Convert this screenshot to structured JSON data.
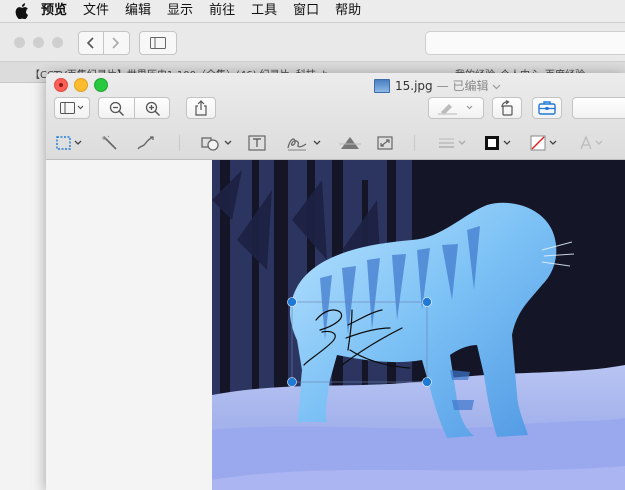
{
  "menubar": {
    "app_name": "预览",
    "items": [
      "文件",
      "编辑",
      "显示",
      "前往",
      "工具",
      "窗口",
      "帮助"
    ]
  },
  "browser": {
    "tab_left": "【CCTV百集纪录片】世界历史1-100（全集）(46) 纪录片, 科技, b...",
    "tab_right": "我的经验_个人中心_百度经验"
  },
  "preview": {
    "filename": "15.jpg",
    "edited_label": "— 已编辑",
    "accent": "#1f7ad6"
  },
  "signature": {
    "text": "张"
  }
}
